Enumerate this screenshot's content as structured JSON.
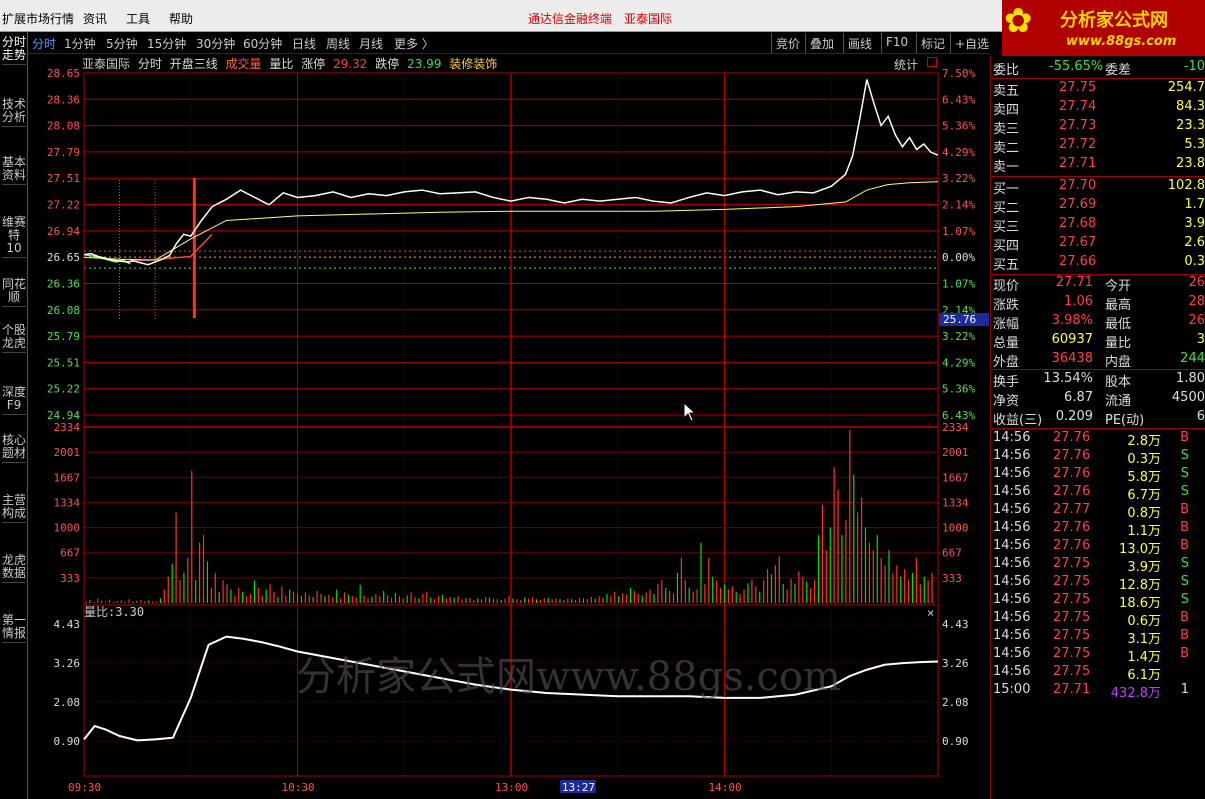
{
  "menu": {
    "items": [
      "扩展市场行情",
      "资讯",
      "工具",
      "帮助"
    ],
    "title_left": "通达信金融终端",
    "title_right": "亚泰国际"
  },
  "logo": {
    "line1": "分析家公式网",
    "line2": "www.88gs.com"
  },
  "sidebar": {
    "tabs": [
      "分时走势",
      "技术分析",
      "基本资料",
      "维赛特10",
      "同花顺",
      "个股龙虎",
      "深度F9",
      "核心题材",
      "主营构成",
      "龙虎数据",
      "第一情报"
    ]
  },
  "periods": {
    "tabs": [
      "分时",
      "1分钟",
      "5分钟",
      "15分钟",
      "30分钟",
      "60分钟",
      "日线",
      "周线",
      "月线",
      "更多 〉"
    ],
    "right_buttons": [
      "竞价",
      "叠加",
      "画线",
      "F10",
      "标记",
      "+自选"
    ]
  },
  "chart_header": {
    "stock": "亚泰国际",
    "mode": "分时",
    "indicator": "开盘三线",
    "vol_label": "成交量",
    "ratio_label": "量比",
    "limit_up_label": "涨停",
    "limit_up": "29.32",
    "limit_down_label": "跌停",
    "limit_down": "23.99",
    "sector": "装修装饰",
    "stat_label": "统计"
  },
  "price_axis": {
    "left": [
      "28.65",
      "28.36",
      "28.08",
      "27.79",
      "27.51",
      "27.22",
      "26.94",
      "26.65",
      "26.36",
      "26.08",
      "25.79",
      "25.51",
      "25.22",
      "24.94"
    ],
    "right": [
      "7.50%",
      "6.43%",
      "5.36%",
      "4.29%",
      "3.22%",
      "2.14%",
      "1.07%",
      "0.00%",
      "1.07%",
      "2.14%",
      "3.22%",
      "4.29%",
      "5.36%",
      "6.43%"
    ],
    "marker": "25.76"
  },
  "volume_axis": {
    "labels": [
      "2334",
      "2001",
      "1667",
      "1334",
      "1000",
      "667",
      "333"
    ]
  },
  "ratio_panel": {
    "label": "量比:3.30",
    "axis": [
      "4.43",
      "3.26",
      "2.08",
      "0.90"
    ],
    "close_icon": "×"
  },
  "time_axis": {
    "labels": [
      "09:30",
      "10:30",
      "13:00",
      "14:00"
    ],
    "cursor_time": "13:27"
  },
  "watermark": "分析家公式网www.88gs.com",
  "quote": {
    "weibi": {
      "label": "委比",
      "value": "-55.65%",
      "label2": "委差",
      "value2": "-10"
    },
    "sells": [
      {
        "label": "卖五",
        "price": "27.75",
        "vol": "254.7"
      },
      {
        "label": "卖四",
        "price": "27.74",
        "vol": "84.3"
      },
      {
        "label": "卖三",
        "price": "27.73",
        "vol": "23.3"
      },
      {
        "label": "卖二",
        "price": "27.72",
        "vol": "5.3"
      },
      {
        "label": "卖一",
        "price": "27.71",
        "vol": "23.8"
      }
    ],
    "buys": [
      {
        "label": "买一",
        "price": "27.70",
        "vol": "102.8"
      },
      {
        "label": "买二",
        "price": "27.69",
        "vol": "1.7"
      },
      {
        "label": "买三",
        "price": "27.68",
        "vol": "3.9"
      },
      {
        "label": "买四",
        "price": "27.67",
        "vol": "2.6"
      },
      {
        "label": "买五",
        "price": "27.66",
        "vol": "0.3"
      }
    ],
    "stats": [
      {
        "l1": "现价",
        "v1": "27.71",
        "l2": "今开",
        "v2": "26"
      },
      {
        "l1": "涨跌",
        "v1": "1.06",
        "l2": "最高",
        "v2": "28"
      },
      {
        "l1": "涨幅",
        "v1": "3.98%",
        "l2": "最低",
        "v2": "26"
      },
      {
        "l1": "总量",
        "v1": "60937",
        "l2": "量比",
        "v2": "3"
      },
      {
        "l1": "外盘",
        "v1": "36438",
        "l2": "内盘",
        "v2": "244"
      }
    ],
    "info": [
      {
        "l1": "换手",
        "v1": "13.54%",
        "l2": "股本",
        "v2": "1.80"
      },
      {
        "l1": "净资",
        "v1": "6.87",
        "l2": "流通",
        "v2": "4500"
      },
      {
        "l1": "收益(三)",
        "v1": "0.209",
        "l2": "PE(动)",
        "v2": "6"
      }
    ],
    "ticks": [
      {
        "time": "14:56",
        "price": "27.76",
        "vol": "2.8万",
        "bs": "B"
      },
      {
        "time": "14:56",
        "price": "27.76",
        "vol": "0.3万",
        "bs": "S"
      },
      {
        "time": "14:56",
        "price": "27.76",
        "vol": "5.8万",
        "bs": "S"
      },
      {
        "time": "14:56",
        "price": "27.76",
        "vol": "6.7万",
        "bs": "S"
      },
      {
        "time": "14:56",
        "price": "27.77",
        "vol": "0.8万",
        "bs": "B"
      },
      {
        "time": "14:56",
        "price": "27.76",
        "vol": "1.1万",
        "bs": "B"
      },
      {
        "time": "14:56",
        "price": "27.76",
        "vol": "13.0万",
        "bs": "B"
      },
      {
        "time": "14:56",
        "price": "27.75",
        "vol": "3.9万",
        "bs": "S"
      },
      {
        "time": "14:56",
        "price": "27.75",
        "vol": "12.8万",
        "bs": "S"
      },
      {
        "time": "14:56",
        "price": "27.75",
        "vol": "18.6万",
        "bs": "S"
      },
      {
        "time": "14:56",
        "price": "27.75",
        "vol": "0.6万",
        "bs": "B"
      },
      {
        "time": "14:56",
        "price": "27.75",
        "vol": "3.1万",
        "bs": "B"
      },
      {
        "time": "14:56",
        "price": "27.75",
        "vol": "1.4万",
        "bs": "B"
      },
      {
        "time": "14:56",
        "price": "27.75",
        "vol": "6.1万",
        "bs": ""
      },
      {
        "time": "15:00",
        "price": "27.71",
        "vol": "432.8万",
        "bs": "1"
      }
    ]
  },
  "colors": {
    "up": "#ff3030",
    "down": "#00e000",
    "price_line": "#ffffff",
    "avg_line": "#ffff66",
    "grid": "#b00000",
    "cyan": "#60ffff",
    "yellow": "#ffff00"
  },
  "chart_data": {
    "type": "line",
    "price_x_minutes": [
      0,
      2,
      4,
      6,
      8,
      10,
      12,
      14,
      16,
      18,
      20,
      22,
      24,
      26,
      28,
      30,
      33,
      36,
      40,
      44,
      48,
      52,
      56,
      60,
      65,
      70,
      75,
      80,
      85,
      90,
      95,
      100,
      105,
      110,
      115,
      120,
      125,
      130,
      135,
      140,
      145,
      150,
      155,
      160,
      165,
      170,
      175,
      180,
      185,
      190,
      195,
      200,
      205,
      210,
      214,
      216,
      218,
      220,
      222,
      224,
      226,
      228,
      230,
      232,
      234,
      236,
      238,
      240
    ],
    "price": [
      26.68,
      26.69,
      26.66,
      26.64,
      26.62,
      26.61,
      26.6,
      26.61,
      26.59,
      26.57,
      26.6,
      26.63,
      26.67,
      26.8,
      26.9,
      26.88,
      27.05,
      27.2,
      27.28,
      27.38,
      27.3,
      27.22,
      27.35,
      27.3,
      27.32,
      27.36,
      27.3,
      27.34,
      27.32,
      27.36,
      27.38,
      27.34,
      27.35,
      27.36,
      27.3,
      27.26,
      27.3,
      27.28,
      27.24,
      27.28,
      27.26,
      27.28,
      27.3,
      27.26,
      27.24,
      27.3,
      27.35,
      27.32,
      27.36,
      27.38,
      27.33,
      27.36,
      27.35,
      27.42,
      27.55,
      27.75,
      28.15,
      28.58,
      28.32,
      28.08,
      28.18,
      27.98,
      27.85,
      27.95,
      27.82,
      27.88,
      27.79,
      27.76
    ],
    "avg_x_minutes": [
      0,
      10,
      20,
      30,
      40,
      60,
      80,
      100,
      120,
      140,
      160,
      180,
      200,
      214,
      220,
      226,
      232,
      240
    ],
    "avg": [
      26.65,
      26.63,
      26.62,
      26.85,
      27.05,
      27.1,
      27.12,
      27.14,
      27.15,
      27.15,
      27.15,
      27.17,
      27.2,
      27.25,
      27.38,
      27.44,
      27.46,
      27.47
    ],
    "volume": [
      20,
      40,
      15,
      60,
      30,
      20,
      45,
      10,
      25,
      35,
      15,
      50,
      20,
      30,
      40,
      25,
      35,
      20,
      15,
      60,
      180,
      350,
      520,
      1200,
      300,
      400,
      600,
      1750,
      300,
      800,
      900,
      550,
      200,
      400,
      150,
      300,
      250,
      180,
      100,
      200,
      150,
      90,
      120,
      300,
      200,
      100,
      180,
      250,
      150,
      80,
      220,
      100,
      180,
      150,
      120,
      90,
      140,
      100,
      80,
      160,
      120,
      90,
      110,
      80,
      180,
      60,
      140,
      110,
      90,
      70,
      240,
      100,
      60,
      80,
      120,
      90,
      160,
      100,
      70,
      130,
      90,
      60,
      100,
      140,
      80,
      60,
      120,
      150,
      70,
      50,
      90,
      110,
      60,
      80,
      70,
      90,
      50,
      60,
      70,
      40,
      60,
      50,
      80,
      70,
      60,
      50,
      40,
      60,
      90,
      60,
      50,
      40,
      70,
      60,
      80,
      50,
      40,
      60,
      70,
      50,
      60,
      50,
      40,
      60,
      50,
      40,
      70,
      60,
      50,
      80,
      60,
      90,
      70,
      120,
      100,
      150,
      90,
      130,
      110,
      200,
      160,
      120,
      100,
      140,
      180,
      120,
      250,
      300,
      200,
      160,
      120,
      400,
      600,
      300,
      200,
      150,
      180,
      800,
      250,
      600,
      350,
      300,
      200,
      250,
      180,
      220,
      150,
      120,
      180,
      260,
      310,
      220,
      150,
      300,
      450,
      380,
      500,
      620,
      250,
      180,
      320,
      260,
      420,
      350,
      280,
      200,
      300,
      900,
      1300,
      700,
      1000,
      1800,
      1500,
      900,
      1100,
      2300,
      1700,
      1200,
      1400,
      1000,
      800,
      700,
      900,
      600,
      500,
      700,
      400,
      500,
      350,
      450,
      300,
      400,
      600,
      250,
      350,
      300,
      400
    ],
    "ratio_x_minutes": [
      0,
      3,
      6,
      10,
      15,
      20,
      25,
      30,
      35,
      40,
      45,
      50,
      55,
      60,
      70,
      80,
      90,
      100,
      110,
      120,
      130,
      140,
      150,
      160,
      170,
      180,
      190,
      200,
      210,
      215,
      220,
      225,
      230,
      235,
      240
    ],
    "ratio": [
      0.95,
      1.35,
      1.25,
      1.05,
      0.92,
      0.95,
      1.0,
      2.2,
      3.8,
      4.05,
      3.98,
      3.88,
      3.75,
      3.6,
      3.4,
      3.2,
      3.0,
      2.8,
      2.6,
      2.45,
      2.35,
      2.3,
      2.25,
      2.25,
      2.25,
      2.2,
      2.2,
      2.3,
      2.55,
      2.85,
      3.05,
      3.2,
      3.25,
      3.28,
      3.3
    ],
    "price_range": [
      24.94,
      28.65
    ],
    "volume_max": 2334,
    "ratio_range": [
      0.9,
      4.43
    ]
  }
}
